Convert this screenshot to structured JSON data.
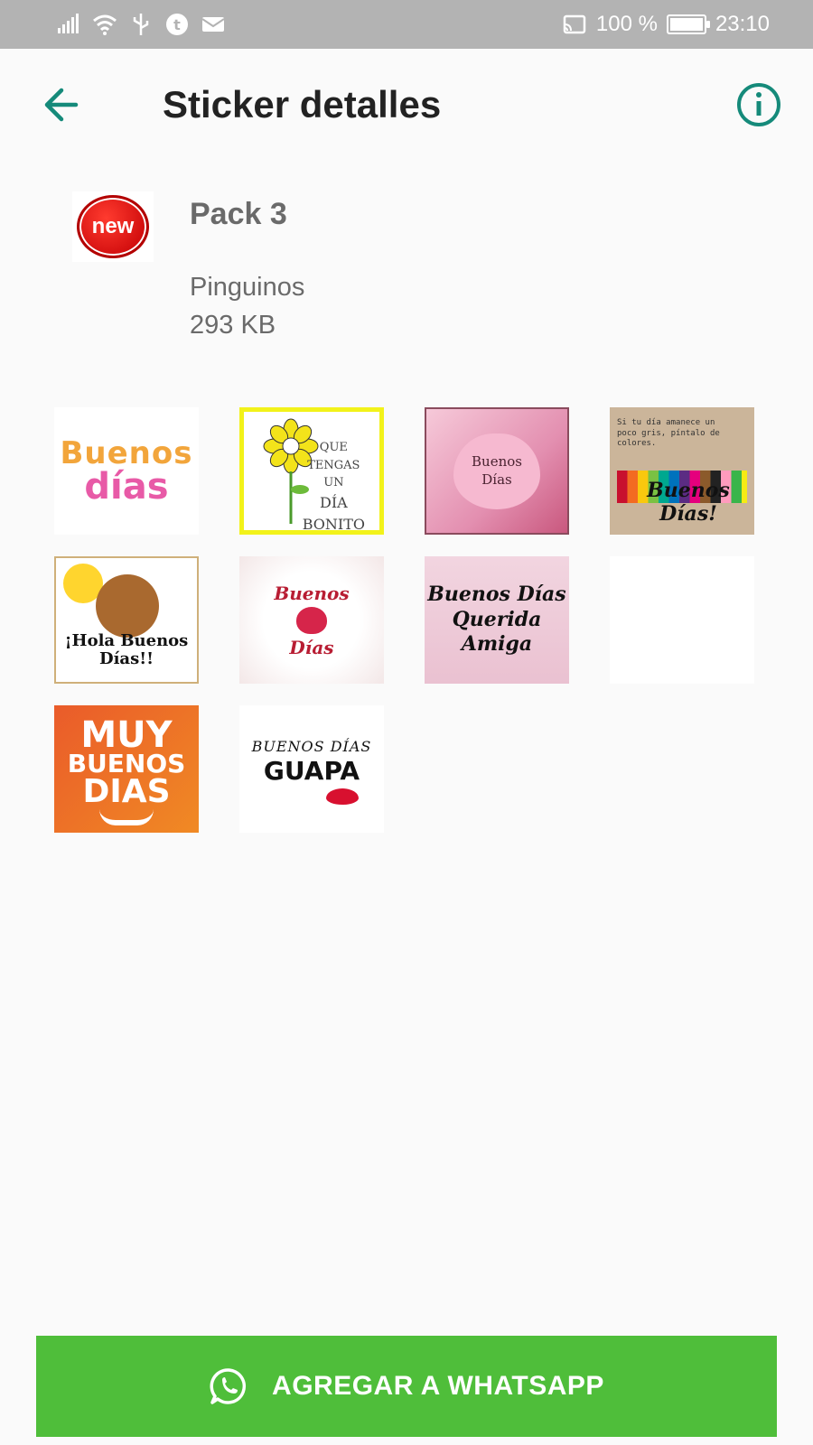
{
  "status_bar": {
    "battery_level": "100 %",
    "battery_fraction": 1.0,
    "time": "23:10"
  },
  "app_bar": {
    "title": "Sticker detalles"
  },
  "pack": {
    "name": "Pack 3",
    "icon_badge": "new",
    "publisher": "Pinguinos",
    "size": "293 KB"
  },
  "stickers": [
    {
      "name": "buenos-dias-colorful",
      "lines": [
        "Buenos",
        "días"
      ]
    },
    {
      "name": "sunflower-que-tengas",
      "lines": [
        "QUE",
        "TENGAS",
        "UN",
        "DÍA",
        "BONITO"
      ]
    },
    {
      "name": "heart-buenos-dias",
      "lines": [
        "Buenos",
        "Días"
      ]
    },
    {
      "name": "pencils-buenos-dias",
      "top_text": "Si tu día amanece un poco gris, píntalo de colores.",
      "script": "Buenos Días!"
    },
    {
      "name": "bear-hola-buenos-dias",
      "lines": [
        "¡Hola Buenos",
        "Días!!"
      ]
    },
    {
      "name": "roses-buenos-dias",
      "lines": [
        "Buenos",
        "Días"
      ]
    },
    {
      "name": "querida-amiga",
      "lines": [
        "Buenos Días",
        "Querida Amiga"
      ]
    },
    {
      "name": "blank-sticker"
    },
    {
      "name": "muy-buenos-dias",
      "lines": [
        "MUY",
        "BUENOS",
        "DIAS"
      ]
    },
    {
      "name": "buenos-dias-guapa",
      "lines": [
        "BUENOS DÍAS",
        "GUAPA"
      ]
    }
  ],
  "add_button": {
    "label": "AGREGAR A WHATSAPP",
    "color": "#4fbe3a"
  },
  "colors": {
    "accent": "#158a7a",
    "status_bar": "#b3b3b3"
  },
  "icons": {
    "back": "arrow-back-icon",
    "info": "info-icon",
    "whatsapp": "whatsapp-icon"
  }
}
